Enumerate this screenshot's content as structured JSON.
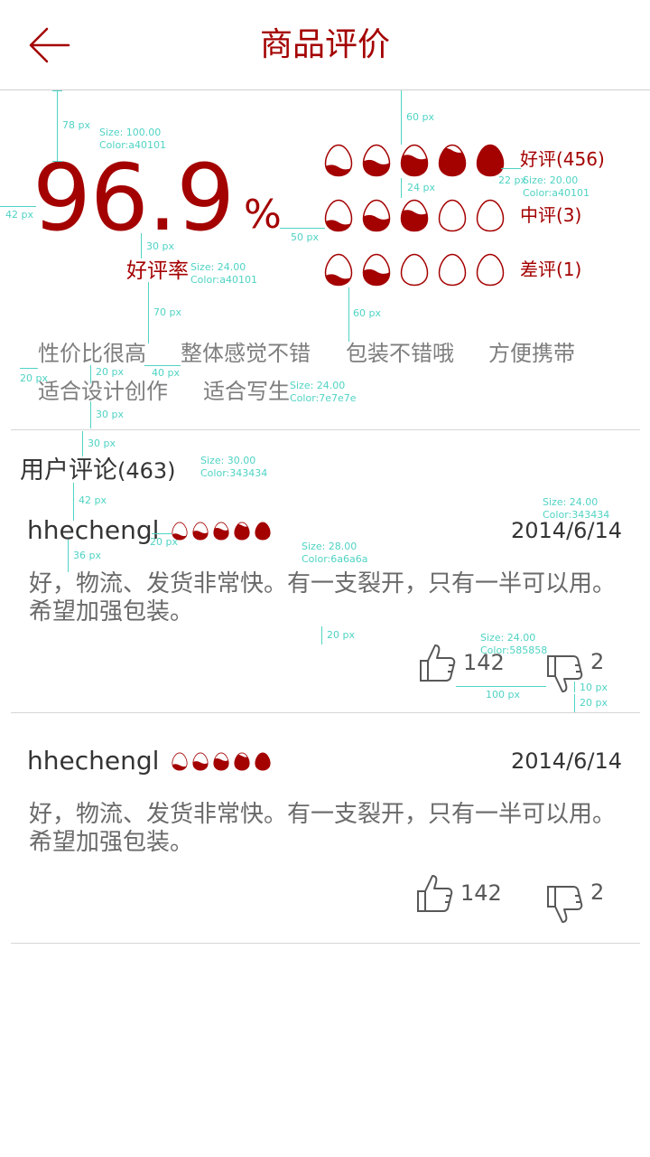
{
  "header": {
    "title": "商品评价",
    "back_icon": "arrow-left-icon"
  },
  "summary": {
    "rate_value": "96.9",
    "rate_percent": "%",
    "rate_label": "好评率",
    "rows": [
      {
        "label": "好评(456)",
        "fills": [
          0.3,
          0.45,
          0.6,
          0.8,
          1.0
        ]
      },
      {
        "label": "中评(3)",
        "fills": [
          0.3,
          0.45,
          0.6,
          0,
          0
        ]
      },
      {
        "label": "差评(1)",
        "fills": [
          0.3,
          0.45,
          0,
          0,
          0
        ]
      }
    ]
  },
  "tags": [
    "性价比很高",
    "整体感觉不错",
    "包装不错哦",
    "方便携带",
    "适合设计创作",
    "适合写生"
  ],
  "comments": {
    "title": "用户评论",
    "count": "(463)",
    "items": [
      {
        "user": "hhechengl",
        "date": "2014/6/14",
        "text": "好，物流、发货非常快。有一支裂开，只有一半可以用。希望加强包装。",
        "likes": "142",
        "dislikes": "2",
        "egg_fills": [
          0.3,
          0.45,
          0.6,
          0.8,
          1.0
        ]
      },
      {
        "user": "hhechengl",
        "date": "2014/6/14",
        "text": "好，物流、发货非常快。有一支裂开，只有一半可以用。希望加强包装。",
        "likes": "142",
        "dislikes": "2",
        "egg_fills": [
          0.3,
          0.45,
          0.6,
          0.8,
          1.0
        ]
      }
    ]
  },
  "annotations": {
    "a78": "78 px",
    "size100": "Size: 100.00",
    "color_a40101": "Color:a40101",
    "a42": "42 px",
    "a30": "30 px",
    "size24": "Size: 24.00",
    "a70": "70 px",
    "a60": "60 px",
    "a24": "24 px",
    "a22": "22 px",
    "size20": "Size: 20.00",
    "a50": "50 px",
    "a20": "20 px",
    "a40": "40 px",
    "color_7e7e7e": "Color:7e7e7e",
    "size30": "Size: 30.00",
    "color_343434": "Color:343434",
    "size28": "Size: 28.00",
    "color_6a6a6a": "Color:6a6a6a",
    "a36": "36 px",
    "color_585858": "Color:585858",
    "a100": "100 px",
    "a10": "10 px"
  },
  "colors": {
    "accent": "#a40101",
    "tag": "#7e7e7e",
    "title": "#343434",
    "body": "#6a6a6a",
    "vote": "#585858",
    "annotation": "#4fd3c4"
  }
}
